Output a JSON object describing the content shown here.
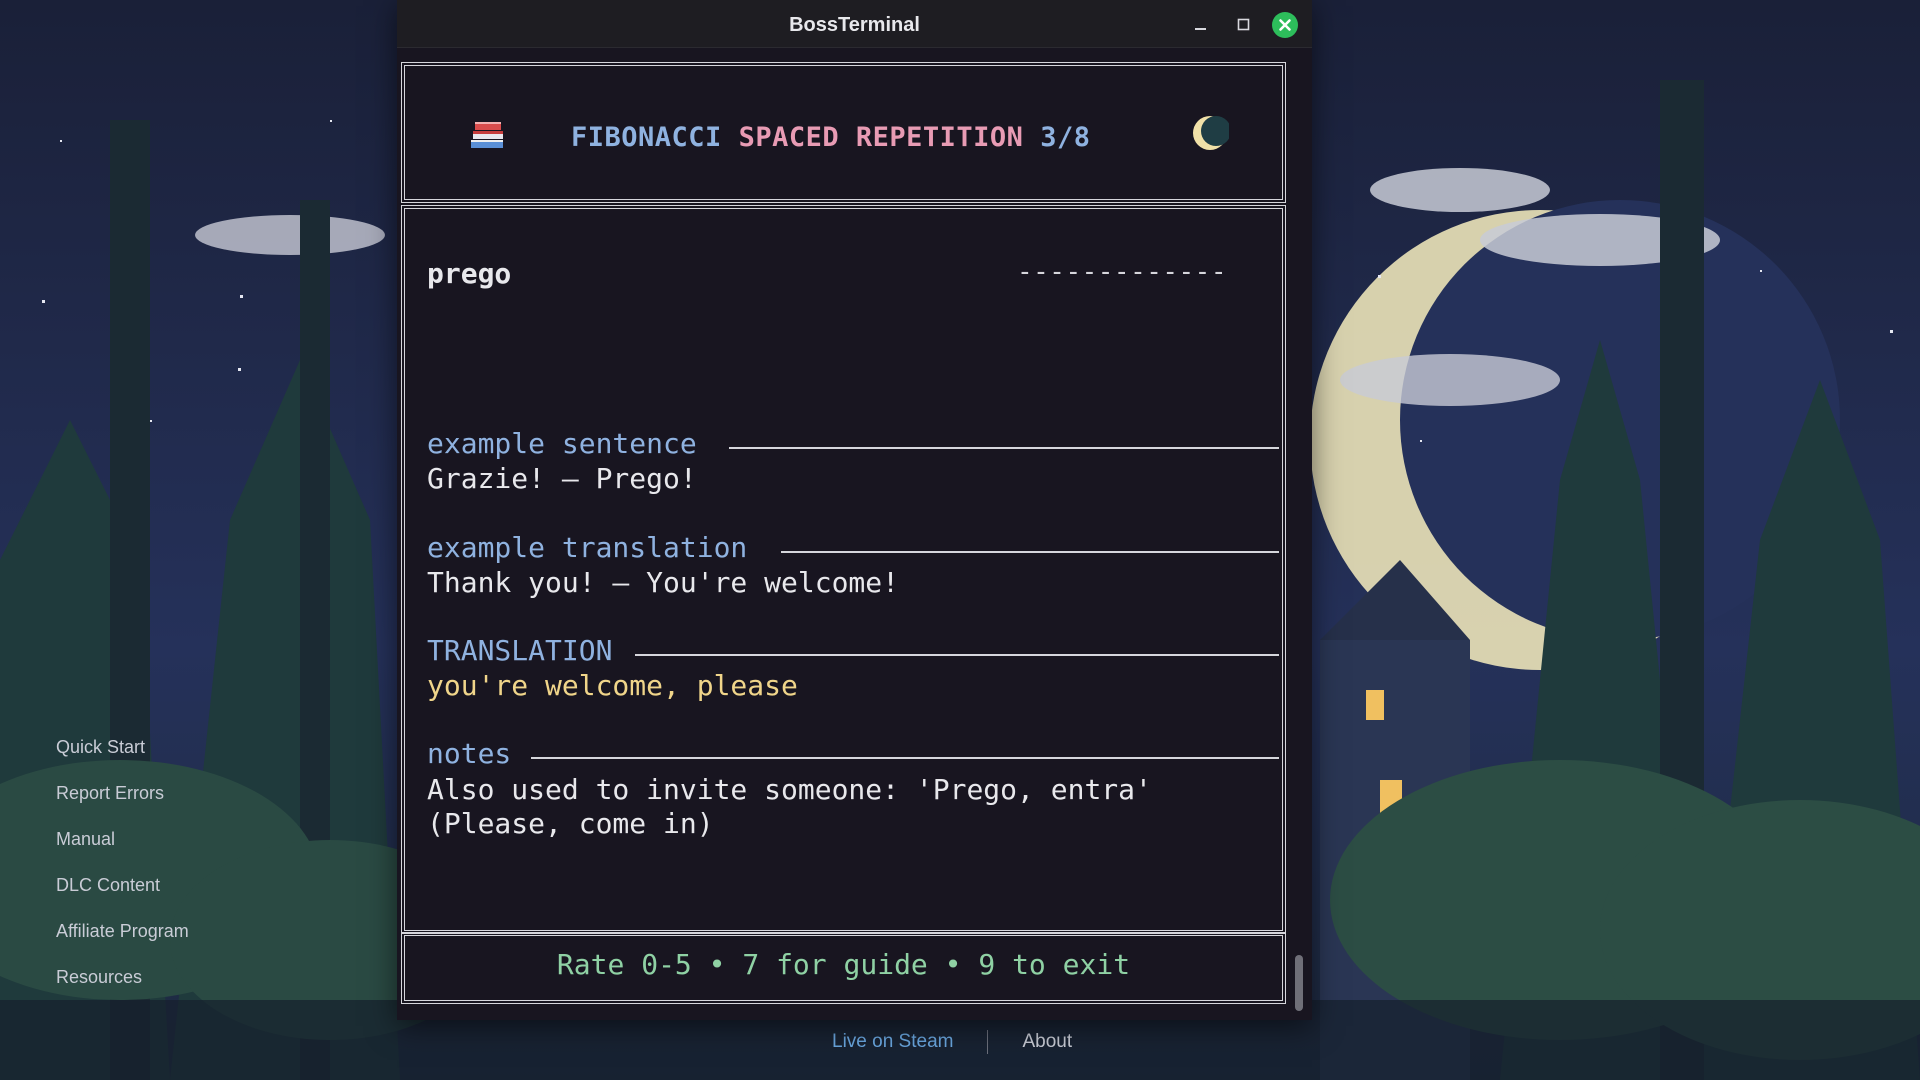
{
  "window": {
    "title": "BossTerminal"
  },
  "header": {
    "title_part1": "FIBONACCI",
    "title_part2": "SPACED REPETITION",
    "progress": "3/8",
    "left_icon": "books-icon",
    "right_icon": "moon-icon"
  },
  "card": {
    "word": "prego",
    "hidden_answer": "-------------",
    "sections": {
      "example_sentence": {
        "label": "example sentence",
        "text": "Grazie! – Prego!"
      },
      "example_translation": {
        "label": "example translation",
        "text": "Thank you! – You're welcome!"
      },
      "translation": {
        "label": "TRANSLATION",
        "text": "you're welcome, please"
      },
      "notes": {
        "label": "notes",
        "line1": "Also used to invite someone: 'Prego, entra'",
        "line2": "(Please, come in)"
      }
    }
  },
  "footer": {
    "hint": "Rate 0-5 • 7 for guide • 9 to exit"
  },
  "side_menu": {
    "items": [
      {
        "label": "Quick Start"
      },
      {
        "label": "Report Errors"
      },
      {
        "label": "Manual"
      },
      {
        "label": "DLC Content"
      },
      {
        "label": "Affiliate Program"
      },
      {
        "label": "Resources"
      }
    ]
  },
  "bottom_links": {
    "steam": "Live on Steam",
    "about": "About"
  },
  "colors": {
    "accent_blue": "#8fb2e0",
    "accent_pink": "#e89bb4",
    "translation_yellow": "#f0d58a",
    "footer_green": "#8fd1a4",
    "close_button": "#2dbd5b"
  }
}
